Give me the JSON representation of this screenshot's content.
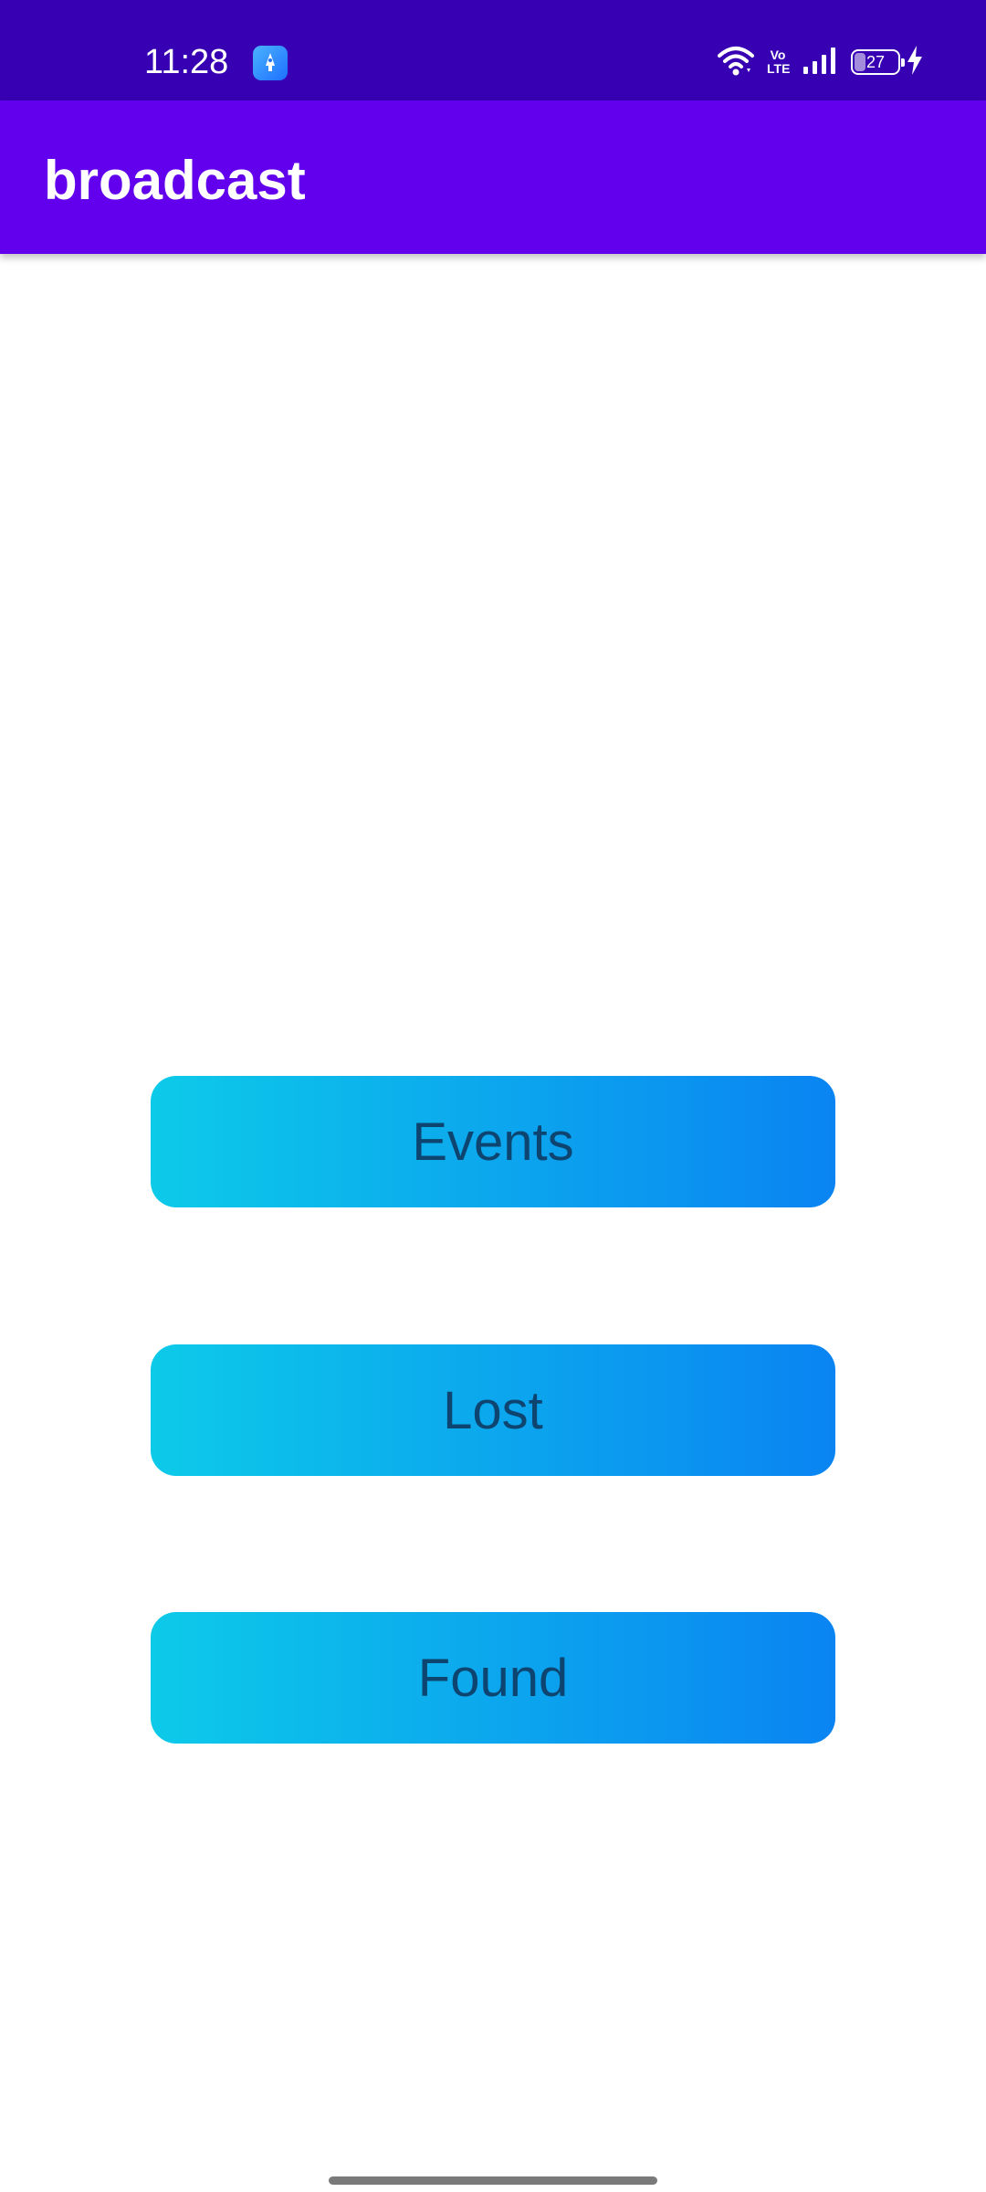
{
  "status_bar": {
    "time": "11:28",
    "volte_label": "Vo\nLTE",
    "battery_level": "27",
    "battery_fraction": 0.27,
    "icons": [
      "app-notification-icon",
      "wifi-icon",
      "volte-icon",
      "signal-icon",
      "battery-icon",
      "charging-icon"
    ],
    "background_color": "#3700b3"
  },
  "app_bar": {
    "title": "broadcast",
    "background_color": "#6200ee"
  },
  "buttons": {
    "events_label": "Events",
    "lost_label": "Lost",
    "found_label": "Found",
    "gradient_start": "#0dcae9",
    "gradient_end": "#0a84f2",
    "text_color": "#0d4570"
  }
}
